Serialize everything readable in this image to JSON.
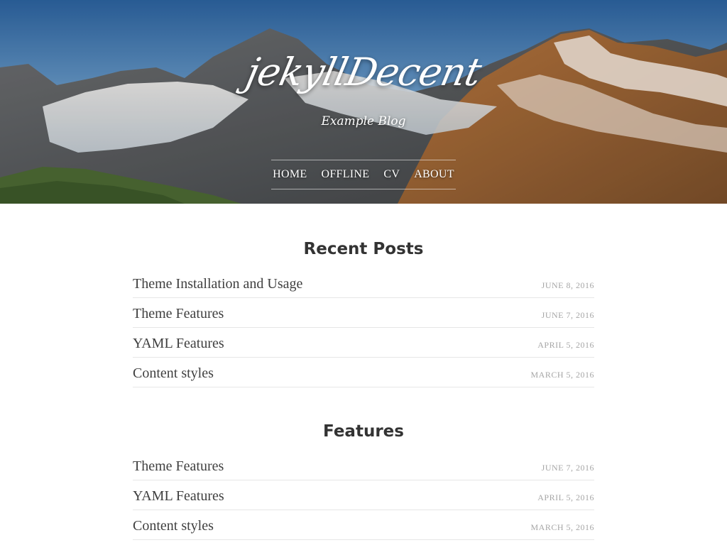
{
  "header": {
    "title": "jekyllDecent",
    "tagline": "Example Blog",
    "nav": [
      {
        "label": "Home"
      },
      {
        "label": "Offline"
      },
      {
        "label": "CV"
      },
      {
        "label": "About"
      }
    ]
  },
  "sections": [
    {
      "heading": "Recent Posts",
      "posts": [
        {
          "title": "Theme Installation and Usage",
          "date": "June 8, 2016"
        },
        {
          "title": "Theme Features",
          "date": "June 7, 2016"
        },
        {
          "title": "YAML Features",
          "date": "April 5, 2016"
        },
        {
          "title": "Content styles",
          "date": "March 5, 2016"
        }
      ]
    },
    {
      "heading": "Features",
      "posts": [
        {
          "title": "Theme Features",
          "date": "June 7, 2016"
        },
        {
          "title": "YAML Features",
          "date": "April 5, 2016"
        },
        {
          "title": "Content styles",
          "date": "March 5, 2016"
        }
      ]
    }
  ],
  "colors": {
    "heading": "#333333",
    "post_title": "#404040",
    "post_date": "#a6a6a6",
    "divider": "#e6e6e6"
  }
}
